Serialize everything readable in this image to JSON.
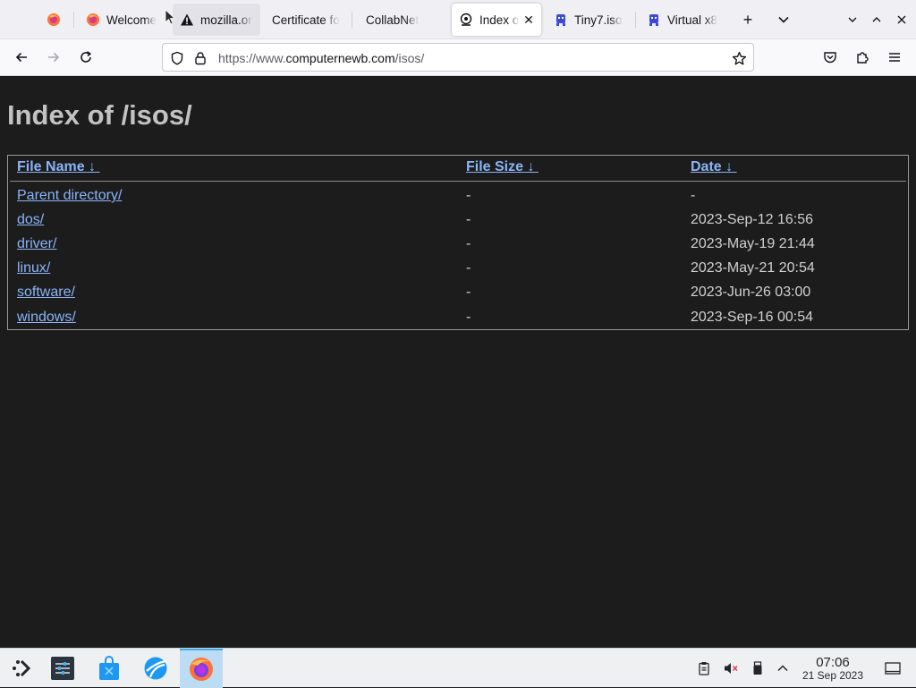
{
  "browser": {
    "tabs": [
      {
        "label": "",
        "favicon": "firefox-icon"
      },
      {
        "label": "Welcome",
        "favicon": "firefox-icon"
      },
      {
        "label": "mozilla.or",
        "favicon": "warning-icon"
      },
      {
        "label": "Certificate fo",
        "favicon": ""
      },
      {
        "label": "CollabNet",
        "favicon": ""
      },
      {
        "label": "Index o",
        "favicon": "page-icon",
        "active": true
      },
      {
        "label": "Tiny7.iso",
        "favicon": "invader-icon"
      },
      {
        "label": "Virtual x8",
        "favicon": "invader-icon"
      }
    ],
    "new_tab_symbol": "+",
    "url": {
      "prefix": "https://www.",
      "host": "computernewb.com",
      "path": "/isos/"
    }
  },
  "page": {
    "title": "Index of /isos/",
    "columns": [
      {
        "label": "File Name",
        "sort": "↓"
      },
      {
        "label": "File Size",
        "sort": "↓"
      },
      {
        "label": "Date",
        "sort": "↓"
      }
    ],
    "rows": [
      {
        "name": "Parent directory/",
        "size": "-",
        "date": "-"
      },
      {
        "name": "dos/",
        "size": "-",
        "date": "2023-Sep-12 16:56"
      },
      {
        "name": "driver/",
        "size": "-",
        "date": "2023-May-19 21:44"
      },
      {
        "name": "linux/",
        "size": "-",
        "date": "2023-May-21 20:54"
      },
      {
        "name": "software/",
        "size": "-",
        "date": "2023-Jun-26 03:00"
      },
      {
        "name": "windows/",
        "size": "-",
        "date": "2023-Sep-16 00:54"
      }
    ]
  },
  "taskbar": {
    "clock_time": "07:06",
    "clock_date": "21 Sep 2023"
  },
  "colors": {
    "page_bg": "#1c1c1c",
    "link": "#8ab4f8",
    "title": "#c2c2c2",
    "taskbar_active": "#bcdcf3"
  }
}
